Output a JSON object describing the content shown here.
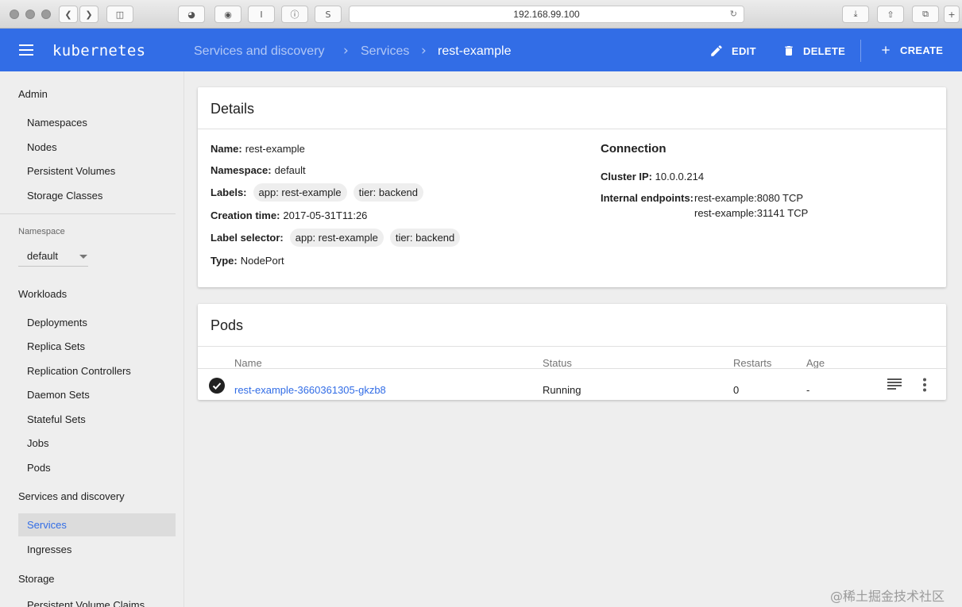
{
  "browser": {
    "url": "192.168.99.100",
    "toolbar_glyphs": [
      "I",
      "S"
    ]
  },
  "appbar": {
    "brand": "kubernetes",
    "breadcrumbs": [
      "Services and discovery",
      "Services",
      "rest-example"
    ],
    "actions": {
      "edit": "EDIT",
      "delete": "DELETE",
      "create": "CREATE"
    },
    "color": "#326de6"
  },
  "sidebar": {
    "admin": {
      "title": "Admin",
      "items": [
        "Namespaces",
        "Nodes",
        "Persistent Volumes",
        "Storage Classes"
      ]
    },
    "namespace": {
      "label": "Namespace",
      "value": "default"
    },
    "workloads": {
      "title": "Workloads",
      "items": [
        "Deployments",
        "Replica Sets",
        "Replication Controllers",
        "Daemon Sets",
        "Stateful Sets",
        "Jobs",
        "Pods"
      ]
    },
    "discovery": {
      "title": "Services and discovery",
      "items": [
        "Services",
        "Ingresses"
      ],
      "active": "Services"
    },
    "storage": {
      "title": "Storage",
      "items": [
        "Persistent Volume Claims"
      ]
    }
  },
  "details": {
    "title": "Details",
    "name_label": "Name:",
    "name": "rest-example",
    "namespace_label": "Namespace:",
    "namespace": "default",
    "labels_label": "Labels:",
    "labels": [
      "app: rest-example",
      "tier: backend"
    ],
    "creation_label": "Creation time:",
    "creation": "2017-05-31T11:26",
    "selector_label": "Label selector:",
    "selector": [
      "app: rest-example",
      "tier: backend"
    ],
    "type_label": "Type:",
    "type": "NodePort",
    "connection": {
      "title": "Connection",
      "cluster_ip_label": "Cluster IP:",
      "cluster_ip": "10.0.0.214",
      "endpoints_label": "Internal endpoints:",
      "endpoints": [
        "rest-example:8080 TCP",
        "rest-example:31141 TCP"
      ]
    }
  },
  "pods": {
    "title": "Pods",
    "columns": [
      "Name",
      "Status",
      "Restarts",
      "Age"
    ],
    "rows": [
      {
        "name": "rest-example-3660361305-gkzb8",
        "status": "Running",
        "restarts": "0",
        "age": "-"
      }
    ]
  },
  "watermark": "@稀土掘金技术社区"
}
